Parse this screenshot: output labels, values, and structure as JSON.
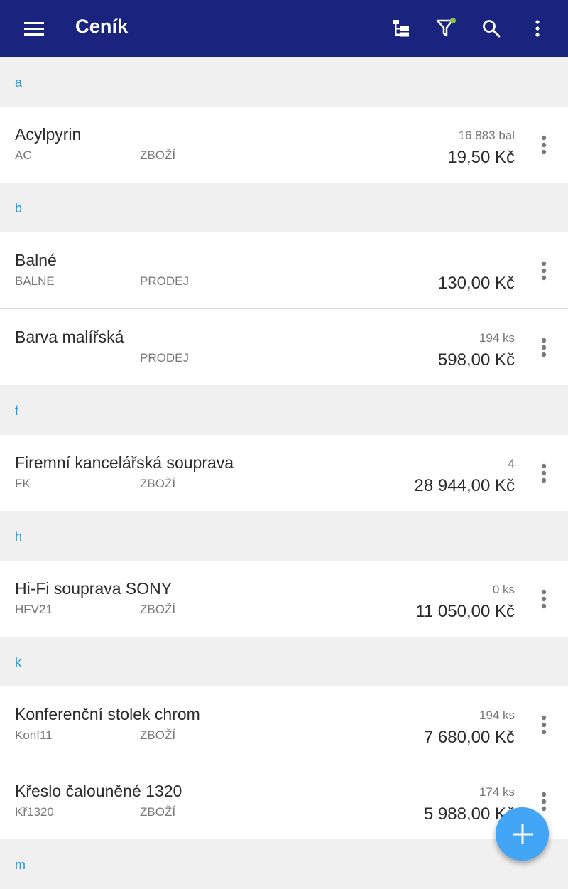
{
  "appbar": {
    "title": "Ceník",
    "icons": [
      "menu-icon",
      "hierarchy-icon",
      "filter-icon",
      "search-icon",
      "more-vert-icon"
    ],
    "filter_badge_color": "#8bc34a",
    "background_color": "#1a237e"
  },
  "accent_color": "#1e9be0",
  "fab_color": "#42a5f5",
  "sections": [
    {
      "letter": "a",
      "items": [
        {
          "name": "Acylpyrin",
          "code": "AC",
          "type": "ZBOŽÍ",
          "qty": "16 883 bal",
          "price": "19,50 Kč"
        }
      ]
    },
    {
      "letter": "b",
      "items": [
        {
          "name": "Balné",
          "code": "BALNE",
          "type": "PRODEJ",
          "qty": "",
          "price": "130,00 Kč"
        },
        {
          "name": "Barva malířská",
          "code": "",
          "type": "PRODEJ",
          "qty": "194 ks",
          "price": "598,00 Kč"
        }
      ]
    },
    {
      "letter": "f",
      "items": [
        {
          "name": "Firemní kancelářská souprava",
          "code": "FK",
          "type": "ZBOŽÍ",
          "qty": "4",
          "price": "28 944,00 Kč"
        }
      ]
    },
    {
      "letter": "h",
      "items": [
        {
          "name": "Hi-Fi souprava SONY",
          "code": "HFV21",
          "type": "ZBOŽÍ",
          "qty": "0 ks",
          "price": "11 050,00 Kč"
        }
      ]
    },
    {
      "letter": "k",
      "items": [
        {
          "name": "Konferenční stolek chrom",
          "code": "Konf11",
          "type": "ZBOŽÍ",
          "qty": "194 ks",
          "price": "7 680,00 Kč"
        },
        {
          "name": "Křeslo čalouněné 1320",
          "code": "Kř1320",
          "type": "ZBOŽÍ",
          "qty": "174 ks",
          "price": "5 988,00 Kč"
        }
      ]
    },
    {
      "letter": "m",
      "items": []
    }
  ]
}
